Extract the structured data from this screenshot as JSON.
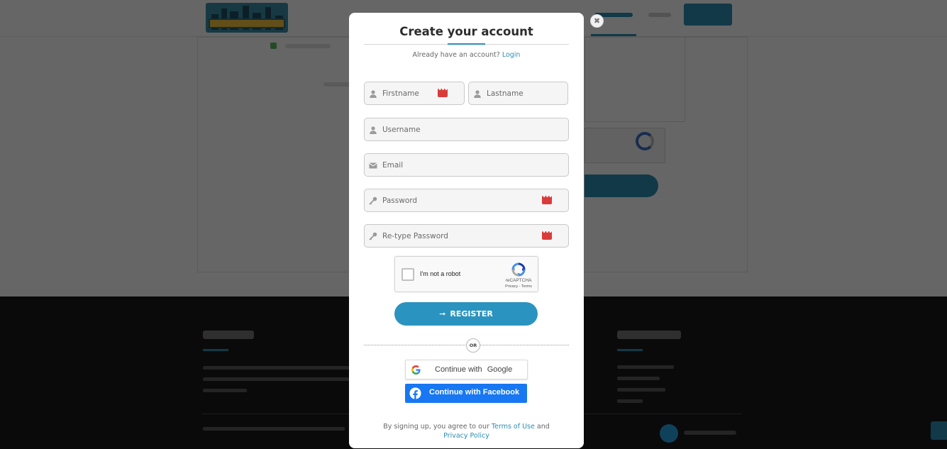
{
  "modal": {
    "title": "Create your account",
    "login_prompt": "Already have an account?",
    "login_link": "Login",
    "close_glyph": "✖"
  },
  "form": {
    "firstname": {
      "placeholder": "Firstname",
      "value": ""
    },
    "lastname": {
      "placeholder": "Lastname",
      "value": ""
    },
    "username": {
      "placeholder": "Username",
      "value": ""
    },
    "email": {
      "placeholder": "Email",
      "value": ""
    },
    "password": {
      "placeholder": "Password",
      "value": ""
    },
    "retype_password": {
      "placeholder": "Re-type Password",
      "value": ""
    }
  },
  "captcha": {
    "label": "I'm not a robot",
    "brand": "reCAPTCHA",
    "links": "Privacy - Terms",
    "checked": false
  },
  "register_button": {
    "label": "REGISTER",
    "icon": "sign-in-arrow-icon"
  },
  "divider": {
    "label": "OR"
  },
  "social": {
    "google_label_prefix": "Continue with ",
    "google_label_brand": "Google",
    "facebook_label": "Continue with Facebook"
  },
  "terms": {
    "prefix": "By signing up, you agree to our",
    "terms_link": "Terms of Use",
    "conjunction": "and",
    "privacy_link": "Privacy Policy"
  },
  "colors": {
    "accent": "#2b8fb3",
    "register_button": "#2b93bf",
    "facebook": "#1877f2",
    "password_key_icon": "#d93b3b",
    "overlay": "rgba(0,0,0,0.6)"
  }
}
